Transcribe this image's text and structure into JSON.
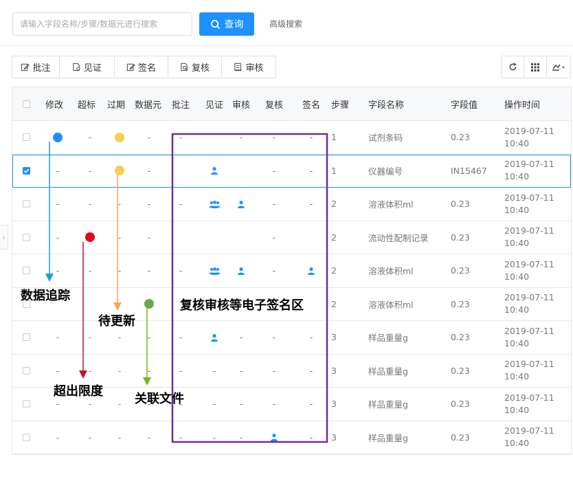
{
  "search": {
    "placeholder": "请输入字段名称/步骤/数据元进行搜索",
    "button_label": "查询",
    "advanced_label": "高级搜索"
  },
  "toolbar": {
    "buttons": [
      {
        "label": "批注",
        "icon": "edit-icon"
      },
      {
        "label": "见证",
        "icon": "witness-icon"
      },
      {
        "label": "签名",
        "icon": "sign-icon"
      },
      {
        "label": "复核",
        "icon": "review-icon"
      },
      {
        "label": "审核",
        "icon": "audit-icon"
      }
    ],
    "right_icons": [
      "refresh-icon",
      "grid-icon",
      "export-icon"
    ]
  },
  "table": {
    "headers": [
      "修改",
      "超标",
      "过期",
      "数据元",
      "批注",
      "见证",
      "审核",
      "复核",
      "签名",
      "步骤",
      "字段名称",
      "字段值",
      "操作时间"
    ],
    "rows": [
      {
        "selected": false,
        "modify": "dot-blue",
        "exceed": "-",
        "expire": "dot-yellow",
        "dataelem": "-",
        "note": "-",
        "witness": "",
        "audit": "-",
        "review": "-",
        "sign": "-",
        "step": "1",
        "field": "试剂条码",
        "value": "0.23",
        "time1": "2019-07-11",
        "time2": "10:40"
      },
      {
        "selected": true,
        "modify": "-",
        "exceed": "-",
        "expire": "dot-yellow",
        "dataelem": "-",
        "note": "",
        "witness": "user",
        "audit": "",
        "review": "-",
        "sign": "-",
        "step": "1",
        "field": "仪器编号",
        "value": "IN15467",
        "time1": "2019-07-11",
        "time2": "10:40"
      },
      {
        "selected": false,
        "modify": "-",
        "exceed": "-",
        "expire": "-",
        "dataelem": "-",
        "note": "-",
        "witness": "group",
        "audit": "user",
        "review": "-",
        "sign": "-",
        "step": "2",
        "field": "溶液体积ml",
        "value": "0.23",
        "time1": "2019-07-11",
        "time2": "10:40"
      },
      {
        "selected": false,
        "modify": "-",
        "exceed": "dot-red",
        "expire": "-",
        "dataelem": "-",
        "note": "",
        "witness": "",
        "audit": "",
        "review": "-",
        "sign": "",
        "step": "2",
        "field": "流动性配制记录",
        "value": "0.23",
        "time1": "2019-07-11",
        "time2": "10:40"
      },
      {
        "selected": false,
        "modify": "-",
        "exceed": "-",
        "expire": "-",
        "dataelem": "-",
        "note": "-",
        "witness": "group",
        "audit": "user",
        "review": "-",
        "sign": "user",
        "step": "2",
        "field": "溶液体积ml",
        "value": "0.23",
        "time1": "2019-07-11",
        "time2": "10:40"
      },
      {
        "selected": false,
        "modify": "",
        "exceed": "",
        "expire": "",
        "dataelem": "dot-green",
        "note": "",
        "witness": "",
        "audit": "",
        "review": "",
        "sign": "",
        "step": "2",
        "field": "溶液体积ml",
        "value": "0.23",
        "time1": "2019-07-11",
        "time2": "10:40"
      },
      {
        "selected": false,
        "modify": "-",
        "exceed": "-",
        "expire": "-",
        "dataelem": "-",
        "note": "-",
        "witness": "user",
        "audit": "-",
        "review": "-",
        "sign": "-",
        "step": "3",
        "field": "样品重量g",
        "value": "0.23",
        "time1": "2019-07-11",
        "time2": "10:40"
      },
      {
        "selected": false,
        "modify": "-",
        "exceed": "-",
        "expire": "-",
        "dataelem": "-",
        "note": "-",
        "witness": "-",
        "audit": "-",
        "review": "-",
        "sign": "-",
        "step": "3",
        "field": "样品重量g",
        "value": "0.23",
        "time1": "2019-07-11",
        "time2": "10:40"
      },
      {
        "selected": false,
        "modify": "-",
        "exceed": "-",
        "expire": "-",
        "dataelem": "-",
        "note": "-",
        "witness": "-",
        "audit": "-",
        "review": "-",
        "sign": "-",
        "step": "3",
        "field": "样品重量g",
        "value": "0.23",
        "time1": "2019-07-11",
        "time2": "10:40"
      },
      {
        "selected": false,
        "modify": "-",
        "exceed": "-",
        "expire": "-",
        "dataelem": "-",
        "note": "-",
        "witness": "-",
        "audit": "-",
        "review": "user",
        "sign": "-",
        "step": "3",
        "field": "样品重量g",
        "value": "0.23",
        "time1": "2019-07-11",
        "time2": "10:40"
      }
    ]
  },
  "callouts": {
    "data_trace": "数据追踪",
    "pending_update": "待更新",
    "exceed_limit": "超出限度",
    "linked_file": "关联文件",
    "esign_area": "复核审核等电子签名区"
  },
  "colors": {
    "primary": "#1e90ff",
    "dot_blue": "#1e90ff",
    "dot_yellow": "#f5d04a",
    "dot_red": "#e8001c",
    "dot_green": "#6aa84f",
    "arrow_blue": "#1e9bd7",
    "arrow_orange": "#f3a45a",
    "arrow_red": "#c0132c",
    "arrow_green": "#7cb518",
    "esign_box": "#6b2fa0"
  }
}
